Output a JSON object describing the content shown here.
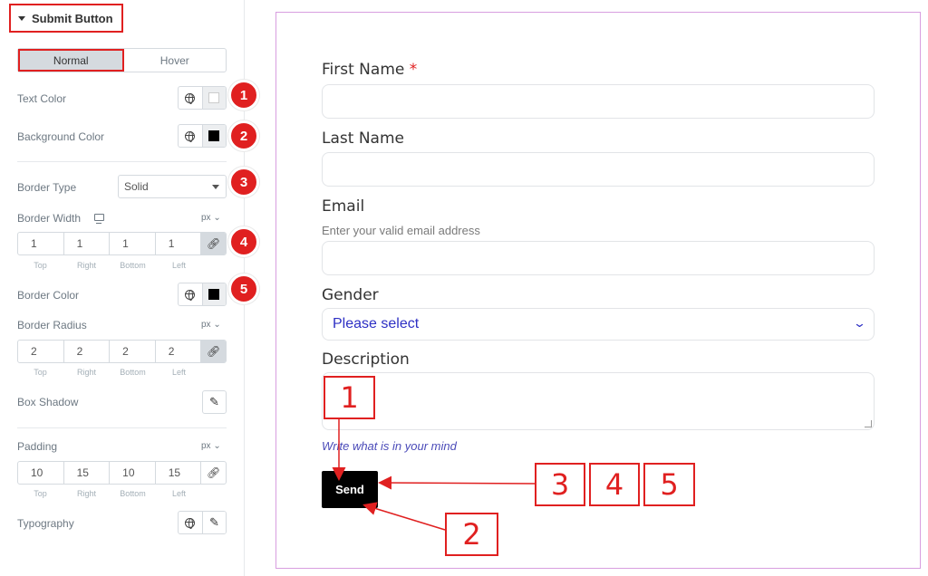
{
  "panel": {
    "section_title": "Submit Button",
    "tabs": [
      "Normal",
      "Hover"
    ],
    "text_color_label": "Text Color",
    "bg_color_label": "Background Color",
    "border_type_label": "Border Type",
    "border_type_value": "Solid",
    "border_width_label": "Border Width",
    "border_width_unit": "px",
    "border_width": [
      "1",
      "1",
      "1",
      "1"
    ],
    "dim_labels": [
      "Top",
      "Right",
      "Bottom",
      "Left"
    ],
    "border_color_label": "Border Color",
    "border_radius_label": "Border Radius",
    "border_radius_unit": "px",
    "border_radius": [
      "2",
      "2",
      "2",
      "2"
    ],
    "box_shadow_label": "Box Shadow",
    "padding_label": "Padding",
    "padding_unit": "px",
    "padding": [
      "10",
      "15",
      "10",
      "15"
    ],
    "typography_label": "Typography",
    "badges": [
      "1",
      "2",
      "3",
      "4",
      "5"
    ],
    "icons": {
      "globe": "globe-icon",
      "link": "link-icon",
      "edit": "pencil-icon",
      "monitor": "desktop-icon",
      "caret": "caret-down-icon"
    },
    "colors": {
      "text_color_swatch": "#ffffff",
      "bg_color_swatch": "#000000",
      "border_color_swatch": "#000000",
      "accent": "#e02020"
    }
  },
  "form": {
    "first_name_label": "First Name",
    "required_mark": "*",
    "last_name_label": "Last Name",
    "email_label": "Email",
    "email_help": "Enter your valid email address",
    "gender_label": "Gender",
    "gender_placeholder": "Please select",
    "description_label": "Description",
    "description_help": "Write what is in your mind",
    "send_label": "Send"
  },
  "callouts": [
    "1",
    "2",
    "3",
    "4",
    "5"
  ]
}
